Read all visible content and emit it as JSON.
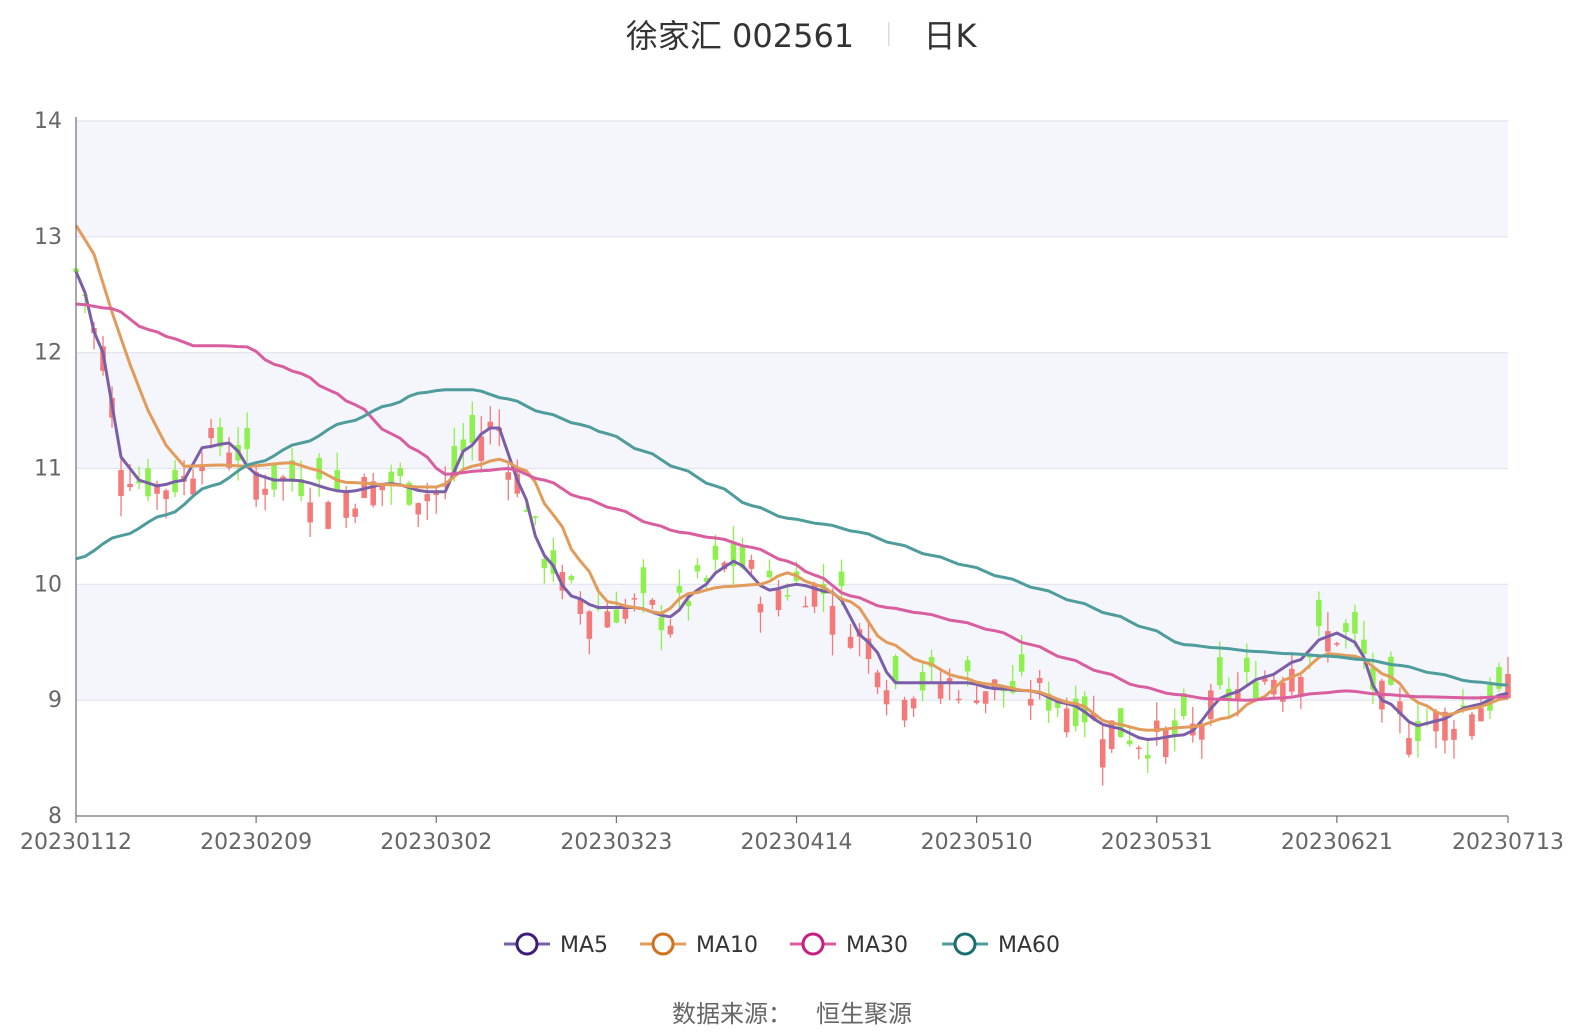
{
  "chart_data": {
    "type": "candlestick",
    "title": "徐家汇 002561",
    "subtitle": "日K",
    "source_label": "数据来源：",
    "source_value": "恒生聚源",
    "y_ticks": [
      8,
      9,
      10,
      11,
      12,
      13,
      14
    ],
    "ylim": [
      8,
      14
    ],
    "x_ticks": [
      "20230112",
      "20230209",
      "20230302",
      "20230323",
      "20230414",
      "20230510",
      "20230531",
      "20230621",
      "20230713"
    ],
    "x_tick_indices": [
      0,
      20,
      40,
      60,
      80,
      100,
      120,
      140,
      159
    ],
    "candle_count": 160,
    "legend_position": "bottom-center",
    "up_color": "#f47a7a",
    "down_color": "#8ef04f",
    "series": [
      {
        "name": "MA5",
        "color": "#7b5ea8",
        "marker_color": "#3c1d7a",
        "anchors": [
          [
            0,
            12.7
          ],
          [
            3,
            12.0
          ],
          [
            5,
            11.1
          ],
          [
            7,
            10.9
          ],
          [
            9,
            10.85
          ],
          [
            12,
            10.9
          ],
          [
            14,
            11.18
          ],
          [
            17,
            11.22
          ],
          [
            20,
            10.95
          ],
          [
            22,
            10.9
          ],
          [
            24,
            10.9
          ],
          [
            30,
            10.8
          ],
          [
            35,
            10.87
          ],
          [
            39,
            10.8
          ],
          [
            41,
            10.8
          ],
          [
            43,
            11.15
          ],
          [
            46,
            11.35
          ],
          [
            47,
            11.35
          ],
          [
            49,
            10.9
          ],
          [
            52,
            10.25
          ],
          [
            55,
            9.9
          ],
          [
            58,
            9.8
          ],
          [
            62,
            9.8
          ],
          [
            66,
            9.72
          ],
          [
            69,
            9.95
          ],
          [
            72,
            10.15
          ],
          [
            73,
            10.2
          ],
          [
            77,
            9.95
          ],
          [
            80,
            10.0
          ],
          [
            84,
            9.93
          ],
          [
            88,
            9.5
          ],
          [
            91,
            9.15
          ],
          [
            94,
            9.15
          ],
          [
            99,
            9.15
          ],
          [
            102,
            9.1
          ],
          [
            106,
            9.08
          ],
          [
            110,
            8.97
          ],
          [
            115,
            8.77
          ],
          [
            119,
            8.66
          ],
          [
            123,
            8.7
          ],
          [
            128,
            9.05
          ],
          [
            132,
            9.2
          ],
          [
            136,
            9.35
          ],
          [
            138,
            9.52
          ],
          [
            140,
            9.58
          ],
          [
            142,
            9.5
          ],
          [
            145,
            9.0
          ],
          [
            149,
            8.78
          ],
          [
            151,
            8.82
          ],
          [
            155,
            8.95
          ],
          [
            159,
            9.06
          ]
        ]
      },
      {
        "name": "MA10",
        "color": "#e29b5b",
        "marker_color": "#d2701c",
        "anchors": [
          [
            0,
            13.1
          ],
          [
            2,
            12.85
          ],
          [
            4,
            12.35
          ],
          [
            6,
            11.9
          ],
          [
            8,
            11.5
          ],
          [
            10,
            11.2
          ],
          [
            12,
            11.02
          ],
          [
            16,
            11.03
          ],
          [
            19,
            11.02
          ],
          [
            24,
            11.05
          ],
          [
            26,
            11.0
          ],
          [
            30,
            10.88
          ],
          [
            35,
            10.86
          ],
          [
            38,
            10.84
          ],
          [
            40,
            10.84
          ],
          [
            44,
            11.02
          ],
          [
            47,
            11.08
          ],
          [
            50,
            10.98
          ],
          [
            53,
            10.6
          ],
          [
            56,
            10.2
          ],
          [
            59,
            9.85
          ],
          [
            62,
            9.8
          ],
          [
            65,
            9.75
          ],
          [
            68,
            9.92
          ],
          [
            72,
            9.98
          ],
          [
            76,
            10.0
          ],
          [
            79,
            10.1
          ],
          [
            82,
            10.0
          ],
          [
            86,
            9.85
          ],
          [
            90,
            9.5
          ],
          [
            94,
            9.33
          ],
          [
            98,
            9.2
          ],
          [
            101,
            9.14
          ],
          [
            106,
            9.08
          ],
          [
            111,
            8.97
          ],
          [
            115,
            8.8
          ],
          [
            119,
            8.74
          ],
          [
            124,
            8.77
          ],
          [
            128,
            8.85
          ],
          [
            131,
            9.0
          ],
          [
            135,
            9.2
          ],
          [
            139,
            9.4
          ],
          [
            142,
            9.38
          ],
          [
            146,
            9.2
          ],
          [
            149,
            8.98
          ],
          [
            152,
            8.87
          ],
          [
            155,
            8.93
          ],
          [
            159,
            9.02
          ]
        ]
      },
      {
        "name": "MA30",
        "color": "#d95ea0",
        "marker_color": "#c71d80",
        "anchors": [
          [
            0,
            12.42
          ],
          [
            4,
            12.38
          ],
          [
            8,
            12.2
          ],
          [
            11,
            12.12
          ],
          [
            13,
            12.06
          ],
          [
            16,
            12.06
          ],
          [
            19,
            12.05
          ],
          [
            22,
            11.9
          ],
          [
            25,
            11.82
          ],
          [
            28,
            11.68
          ],
          [
            31,
            11.55
          ],
          [
            35,
            11.3
          ],
          [
            38,
            11.15
          ],
          [
            41,
            10.95
          ],
          [
            45,
            10.98
          ],
          [
            48,
            11.0
          ],
          [
            52,
            10.9
          ],
          [
            56,
            10.75
          ],
          [
            60,
            10.65
          ],
          [
            64,
            10.52
          ],
          [
            67,
            10.45
          ],
          [
            71,
            10.4
          ],
          [
            75,
            10.32
          ],
          [
            79,
            10.2
          ],
          [
            82,
            10.08
          ],
          [
            86,
            9.9
          ],
          [
            90,
            9.8
          ],
          [
            94,
            9.75
          ],
          [
            98,
            9.68
          ],
          [
            102,
            9.6
          ],
          [
            106,
            9.48
          ],
          [
            110,
            9.36
          ],
          [
            114,
            9.24
          ],
          [
            118,
            9.12
          ],
          [
            122,
            9.05
          ],
          [
            126,
            9.01
          ],
          [
            130,
            9.0
          ],
          [
            134,
            9.02
          ],
          [
            138,
            9.06
          ],
          [
            141,
            9.08
          ],
          [
            145,
            9.05
          ],
          [
            149,
            9.03
          ],
          [
            155,
            9.02
          ],
          [
            159,
            9.03
          ]
        ]
      },
      {
        "name": "MA60",
        "color": "#4f9c9d",
        "marker_color": "#1b6e6f",
        "anchors": [
          [
            0,
            10.22
          ],
          [
            5,
            10.42
          ],
          [
            10,
            10.6
          ],
          [
            15,
            10.85
          ],
          [
            20,
            11.05
          ],
          [
            25,
            11.22
          ],
          [
            30,
            11.4
          ],
          [
            35,
            11.55
          ],
          [
            38,
            11.65
          ],
          [
            41,
            11.68
          ],
          [
            44,
            11.68
          ],
          [
            48,
            11.6
          ],
          [
            52,
            11.48
          ],
          [
            56,
            11.38
          ],
          [
            59,
            11.3
          ],
          [
            63,
            11.15
          ],
          [
            67,
            11.0
          ],
          [
            71,
            10.85
          ],
          [
            75,
            10.68
          ],
          [
            79,
            10.57
          ],
          [
            83,
            10.52
          ],
          [
            87,
            10.45
          ],
          [
            91,
            10.35
          ],
          [
            95,
            10.25
          ],
          [
            99,
            10.16
          ],
          [
            103,
            10.06
          ],
          [
            107,
            9.96
          ],
          [
            111,
            9.85
          ],
          [
            115,
            9.74
          ],
          [
            119,
            9.62
          ],
          [
            123,
            9.48
          ],
          [
            127,
            9.45
          ],
          [
            131,
            9.42
          ],
          [
            135,
            9.4
          ],
          [
            139,
            9.38
          ],
          [
            143,
            9.35
          ],
          [
            147,
            9.3
          ],
          [
            151,
            9.23
          ],
          [
            155,
            9.16
          ],
          [
            159,
            9.13
          ]
        ]
      }
    ]
  }
}
